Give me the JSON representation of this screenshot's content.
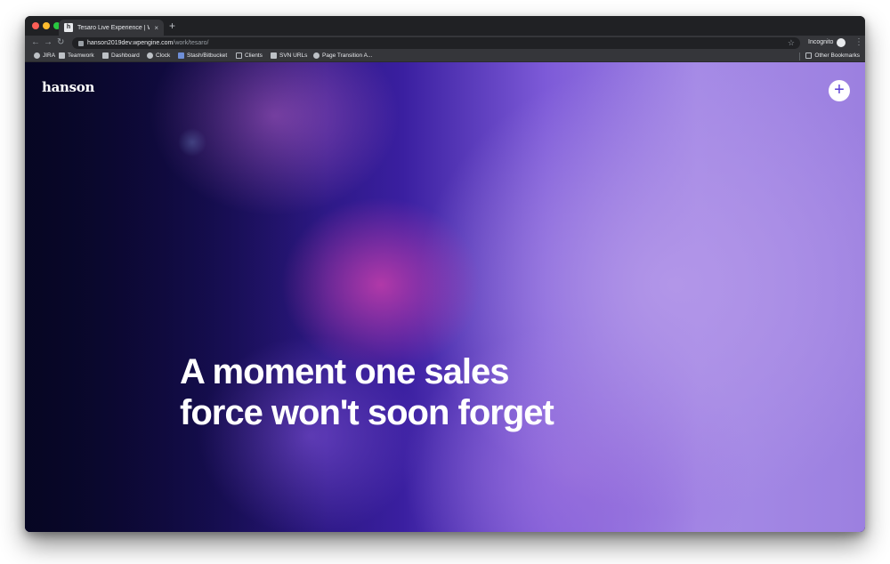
{
  "browser": {
    "tab": {
      "title": "Tesaro Live Experience | Work",
      "favicon": "h",
      "close": "×"
    },
    "new_tab": "+",
    "url": {
      "host": "hanson2019dev.wpengine.com",
      "path": "/work/tesaro/"
    },
    "incognito_label": "Incognito",
    "bookmarks": [
      {
        "label": "JIRA",
        "icon": "jira-icon"
      },
      {
        "label": "Teamwork",
        "icon": "h-favicon-icon"
      },
      {
        "label": "Dashboard",
        "icon": "h-favicon-icon"
      },
      {
        "label": "Clock",
        "icon": "clock-icon"
      },
      {
        "label": "Stash/Bitbucket",
        "icon": "bitbucket-icon"
      },
      {
        "label": "Clients",
        "icon": "folder-icon"
      },
      {
        "label": "SVN URLs",
        "icon": "h-favicon-icon"
      },
      {
        "label": "Page Transition A...",
        "icon": "gear-icon"
      }
    ],
    "other_bookmarks": "Other Bookmarks"
  },
  "page": {
    "logo": "hanson",
    "menu_button": "+",
    "headline": "A moment one sales force won't soon forget",
    "accent_color": "#5b3fd6"
  }
}
